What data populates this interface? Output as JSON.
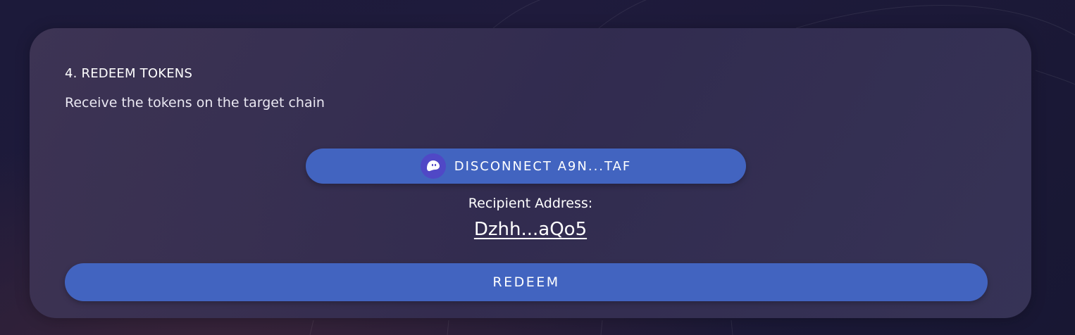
{
  "step": {
    "title": "4. REDEEM TOKENS",
    "description": "Receive the tokens on the target chain"
  },
  "wallet": {
    "icon": "phantom-ghost-icon",
    "button_label": "DISCONNECT A9N...TAF"
  },
  "recipient": {
    "label": "Recipient Address:",
    "address": "Dzhh...aQo5"
  },
  "actions": {
    "redeem_label": "REDEEM"
  },
  "colors": {
    "button_blue": "#4264c0",
    "wallet_icon_purple": "#5048c6",
    "background": "#1c1a3a"
  }
}
